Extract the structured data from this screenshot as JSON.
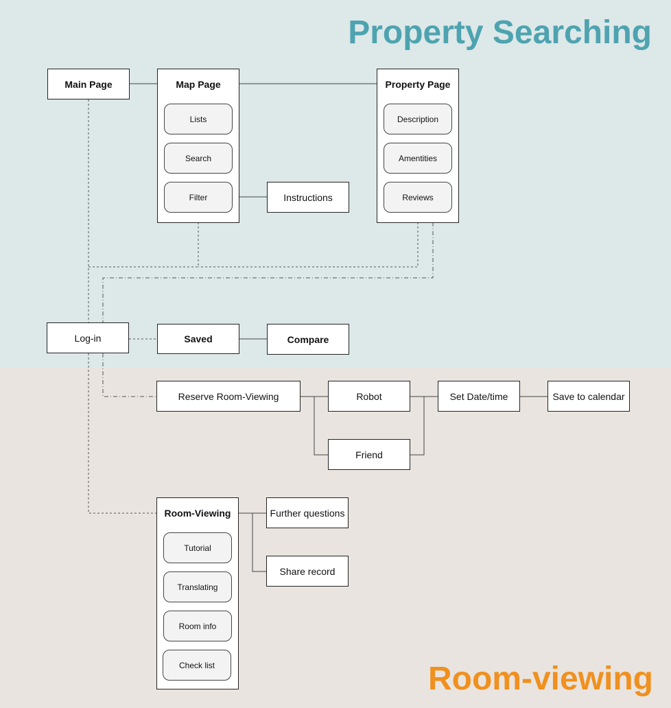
{
  "sections": {
    "top_title": "Property Searching",
    "bottom_title": "Room-viewing",
    "top_color": "#4ea3b0",
    "bottom_color": "#f0901e"
  },
  "nodes": {
    "main_page": "Main Page",
    "map_page": "Map Page",
    "lists": "Lists",
    "search": "Search",
    "filter": "Filter",
    "instructions": "Instructions",
    "property_page": "Property Page",
    "description": "Description",
    "amentities": "Amentities",
    "reviews": "Reviews",
    "log_in": "Log-in",
    "saved": "Saved",
    "compare": "Compare",
    "reserve": "Reserve Room-Viewing",
    "robot": "Robot",
    "friend": "Friend",
    "set_datetime": "Set Date/time",
    "save_calendar": "Save to calendar",
    "room_viewing": "Room-Viewing",
    "tutorial": "Tutorial",
    "translating": "Translating",
    "room_info": "Room info",
    "check_list": "Check list",
    "further_questions": "Further questions",
    "share_record": "Share record"
  }
}
